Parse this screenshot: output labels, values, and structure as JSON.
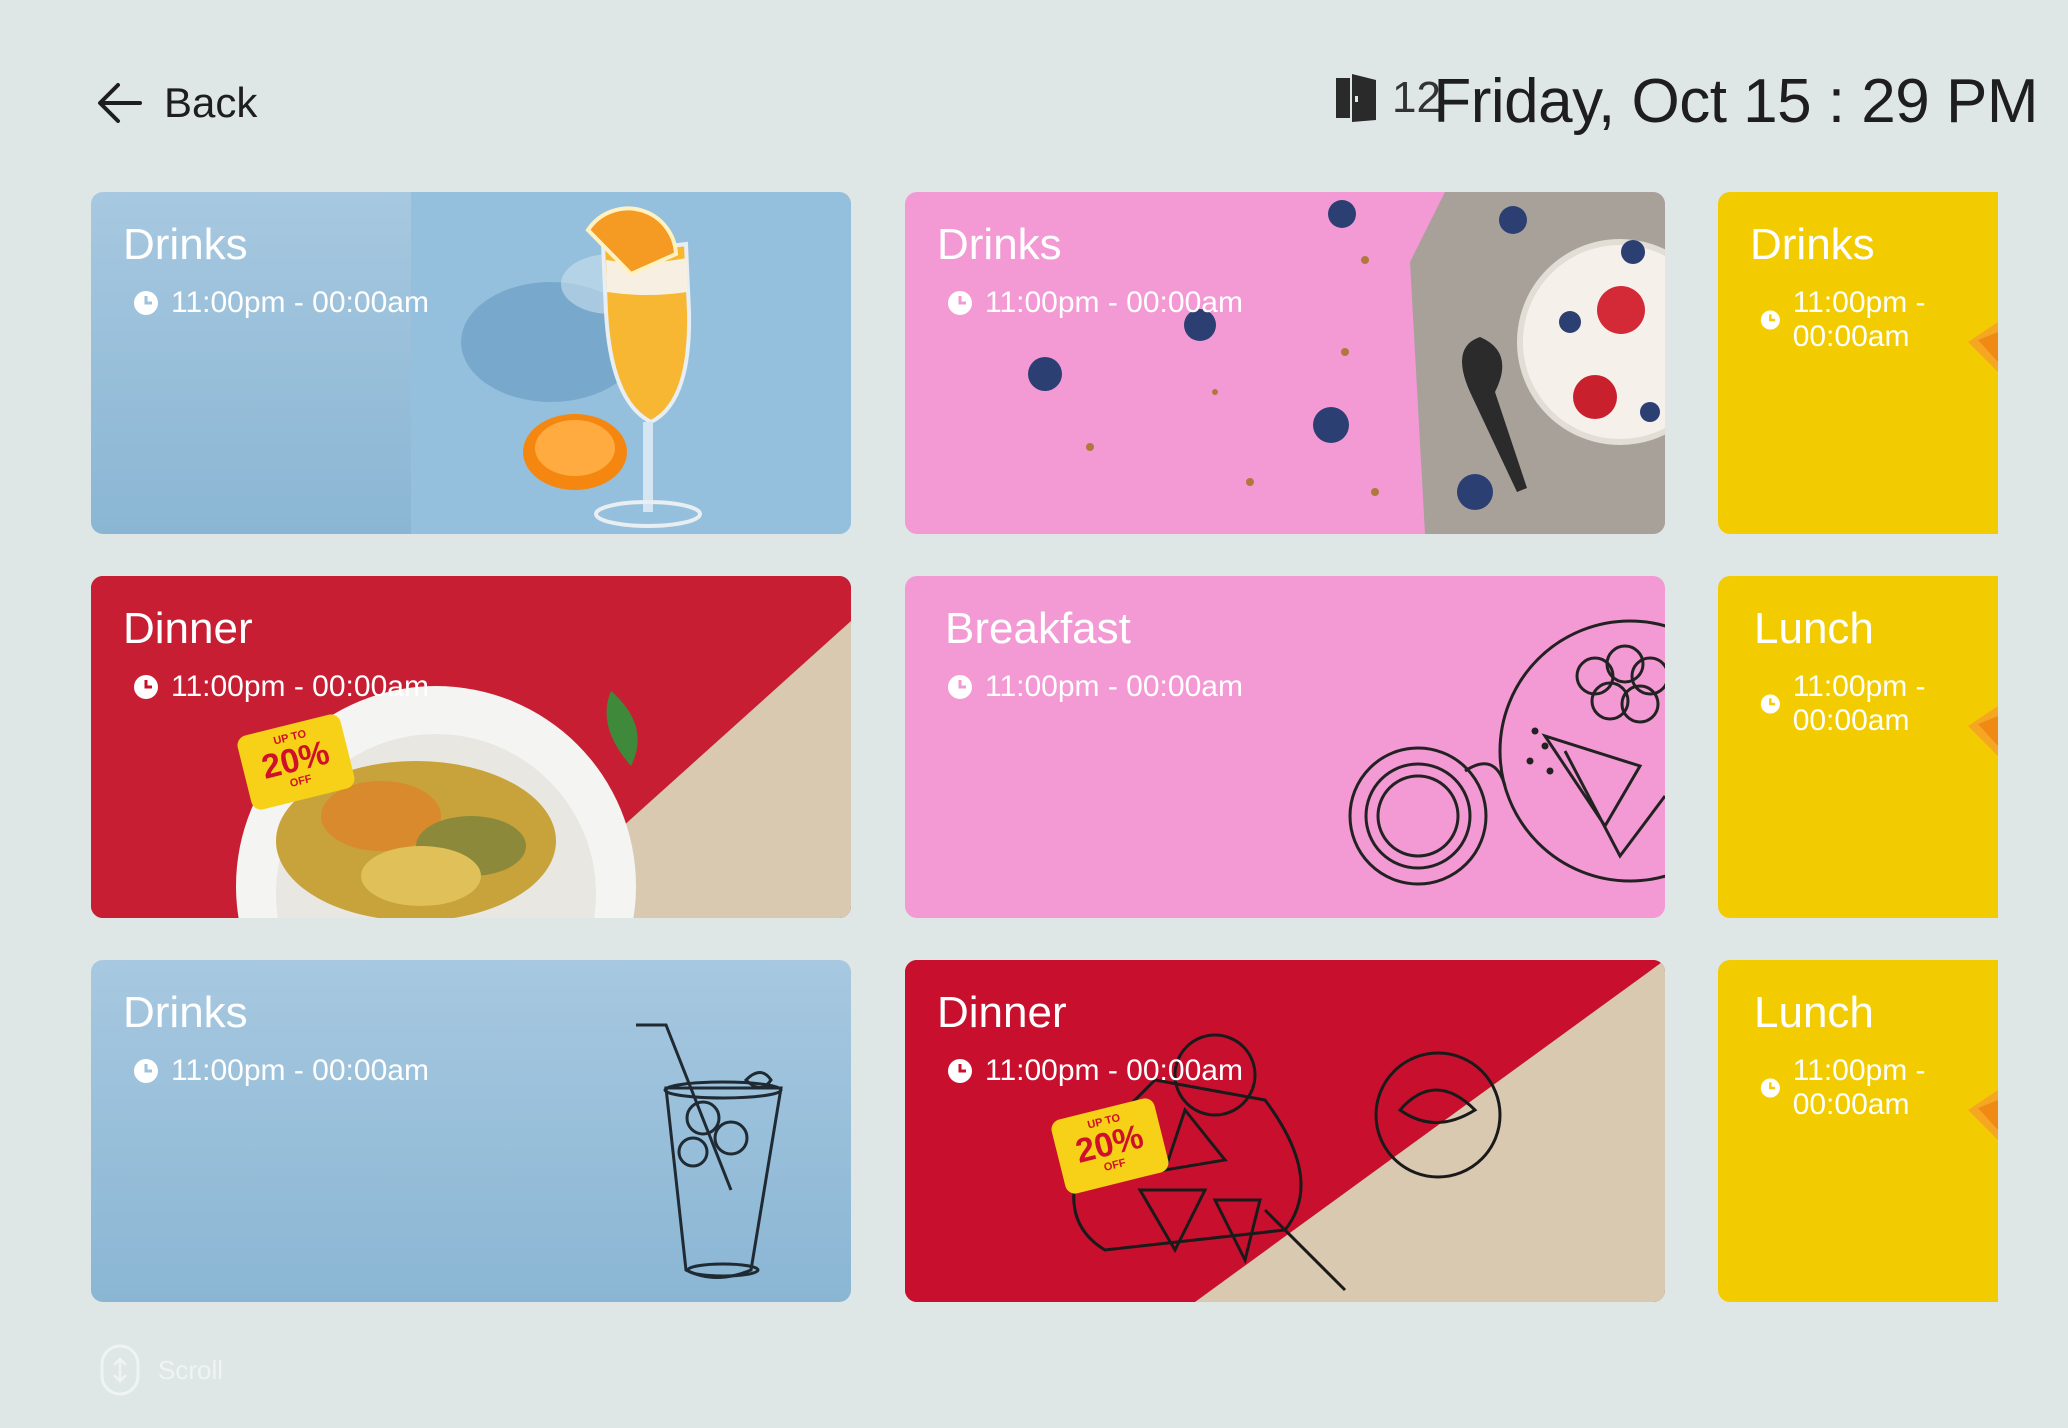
{
  "header": {
    "back_label": "Back",
    "room_number": "12",
    "datetime": "Friday, Oct 15 : 29 PM"
  },
  "cards": [
    {
      "title": "Drinks",
      "time": "11:00pm - 00:00am",
      "color": "#9cc2dd"
    },
    {
      "title": "Drinks",
      "time": "11:00pm - 00:00am",
      "color": "#f39ad5"
    },
    {
      "title": "Drinks",
      "time": "11:00pm - 00:00am",
      "color": "#f2cc00"
    },
    {
      "title": "Dinner",
      "time": "11:00pm - 00:00am",
      "color": "#c8102e",
      "badge": {
        "top": "UP TO",
        "value": "20%",
        "bottom": "OFF"
      }
    },
    {
      "title": "Breakfast",
      "time": "11:00pm - 00:00am",
      "color": "#f39ad5"
    },
    {
      "title": "Lunch",
      "time": "11:00pm - 00:00am",
      "color": "#f2cc00"
    },
    {
      "title": "Drinks",
      "time": "11:00pm - 00:00am",
      "color": "#9cc2dd"
    },
    {
      "title": "Dinner",
      "time": "11:00pm - 00:00am",
      "color": "#c8102e",
      "badge": {
        "top": "UP TO",
        "value": "20%",
        "bottom": "OFF"
      }
    },
    {
      "title": "Lunch",
      "time": "11:00pm - 00:00am",
      "color": "#f2cc00"
    }
  ],
  "footer": {
    "scroll_label": "Scroll"
  },
  "icons": {
    "back": "arrow-left-icon",
    "room": "door-icon",
    "time": "clock-icon",
    "scroll": "scroll-icon"
  }
}
